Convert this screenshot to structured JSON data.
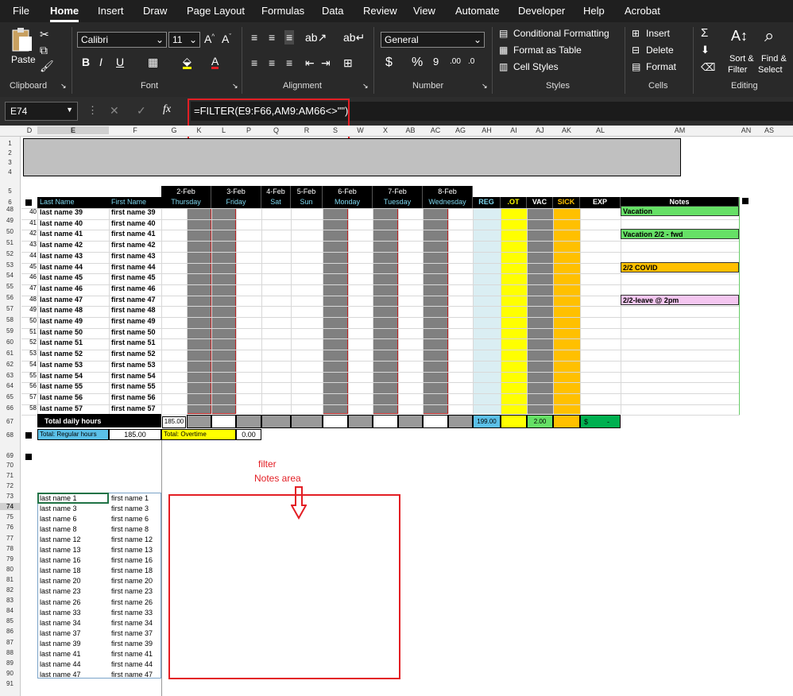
{
  "menu": [
    "File",
    "Home",
    "Insert",
    "Draw",
    "Page Layout",
    "Formulas",
    "Data",
    "Review",
    "View",
    "Automate",
    "Developer",
    "Help",
    "Acrobat"
  ],
  "ribbon": {
    "paste_label": "Paste",
    "font_name": "Calibri",
    "font_size": "11",
    "number_format": "General",
    "cond_format": "Conditional Formatting",
    "format_table": "Format as Table",
    "cell_styles": "Cell Styles",
    "insert": "Insert",
    "delete": "Delete",
    "format": "Format",
    "sort_filter": [
      "Sort &",
      "Filter"
    ],
    "find_select": [
      "Find &",
      "Select"
    ],
    "groups": [
      "Clipboard",
      "Font",
      "Alignment",
      "Number",
      "Styles",
      "Cells",
      "Editing"
    ]
  },
  "formula_bar": {
    "name_box": "E74",
    "formula": "=FILTER(E9:F66,AM9:AM66<>\"\")"
  },
  "col_headers": [
    "D",
    "E",
    "F",
    "G",
    "K",
    "L",
    "P",
    "Q",
    "R",
    "S",
    "W",
    "X",
    "AB",
    "AC",
    "AG",
    "AH",
    "AI",
    "AJ",
    "AK",
    "AL",
    "AM",
    "AN",
    "AS"
  ],
  "row_headers_top": [
    "1",
    "2",
    "3",
    "4",
    "5",
    "6",
    "48",
    "49",
    "50",
    "51",
    "52",
    "53",
    "54",
    "55",
    "56",
    "57",
    "58",
    "59",
    "60",
    "61",
    "62",
    "63",
    "64",
    "65",
    "66",
    "67",
    "68",
    "69",
    "70",
    "71",
    "72",
    "73",
    "74",
    "75",
    "76",
    "77",
    "78",
    "79",
    "80",
    "81",
    "82",
    "83",
    "84",
    "85",
    "86",
    "87",
    "88",
    "89",
    "90",
    "91"
  ],
  "table": {
    "col_last": "Last Name",
    "col_first": "First Name",
    "dates": [
      "2-Feb",
      "3-Feb",
      "4-Feb",
      "5-Feb",
      "6-Feb",
      "7-Feb",
      "8-Feb"
    ],
    "days": [
      "Thursday",
      "Friday",
      "Sat",
      "Sun",
      "Monday",
      "Tuesday",
      "Wednesday"
    ],
    "summary_cols": [
      "REG",
      ".OT",
      "VAC",
      "SICK",
      "EXP",
      "Notes"
    ],
    "row_ids": [
      "40",
      "41",
      "42",
      "43",
      "44",
      "45",
      "46",
      "47",
      "48",
      "49",
      "50",
      "51",
      "52",
      "53",
      "54",
      "55",
      "56",
      "57",
      "58"
    ],
    "last_names": [
      "last name 39",
      "last name 40",
      "last name 41",
      "last name 42",
      "last name 43",
      "last name 44",
      "last name 45",
      "last name 46",
      "last name 47",
      "last name 48",
      "last name 49",
      "last name 50",
      "last name 51",
      "last name 52",
      "last name 53",
      "last name 54",
      "last name 55",
      "last name 56",
      "last name 57"
    ],
    "first_names": [
      "first name 39",
      "first name 40",
      "first name 41",
      "first name 42",
      "first name 43",
      "first name 44",
      "first name 45",
      "first name 46",
      "first name 47",
      "first name 48",
      "first name 49",
      "first name 50",
      "first name 51",
      "first name 52",
      "first name 53",
      "first name 54",
      "first name 55",
      "first name 56",
      "first name 57"
    ],
    "notes": [
      "Vacation",
      "",
      "Vacation 2/2 - fwd",
      "",
      "",
      "2/2 COVID",
      "",
      "",
      "2/2-leave @ 2pm",
      "",
      "",
      "",
      "",
      "",
      "",
      "",
      "",
      "",
      ""
    ]
  },
  "totals": {
    "daily_label": "Total daily hours",
    "daily_value": "185.00",
    "reg_value": "199.00",
    "vac_value": "2.00",
    "exp_value": "$",
    "exp_dash": "-",
    "regular_label": "Total: Regular hours",
    "regular_value": "185.00",
    "overtime_label": "Total: Overtime",
    "overtime_value": "0.00"
  },
  "annotation": [
    "filter",
    "Notes area"
  ],
  "filter_last": [
    "last name 1",
    "last name 3",
    "last name 6",
    "last name 8",
    "last name 12",
    "last name 13",
    "last name 16",
    "last name 18",
    "last name 20",
    "last name 23",
    "last name 26",
    "last name 33",
    "last name 34",
    "last name 37",
    "last name 39",
    "last name 41",
    "last name 44",
    "last name 47"
  ],
  "filter_first": [
    "first name 1",
    "first name 3",
    "first name 6",
    "first name 8",
    "first name 12",
    "first name 13",
    "first name 16",
    "first name 18",
    "first name 20",
    "first name 23",
    "first name 26",
    "first name 33",
    "first name 34",
    "first name 37",
    "first name 39",
    "first name 41",
    "first name 44",
    "first name 47"
  ],
  "colors": {
    "ribbon_bg": "#292929",
    "reg": "#daeef3",
    "ot": "#ffff00",
    "vac": "#808080",
    "sick": "#ffc000",
    "notes_green": "#66e066",
    "red": "#e31e24"
  }
}
